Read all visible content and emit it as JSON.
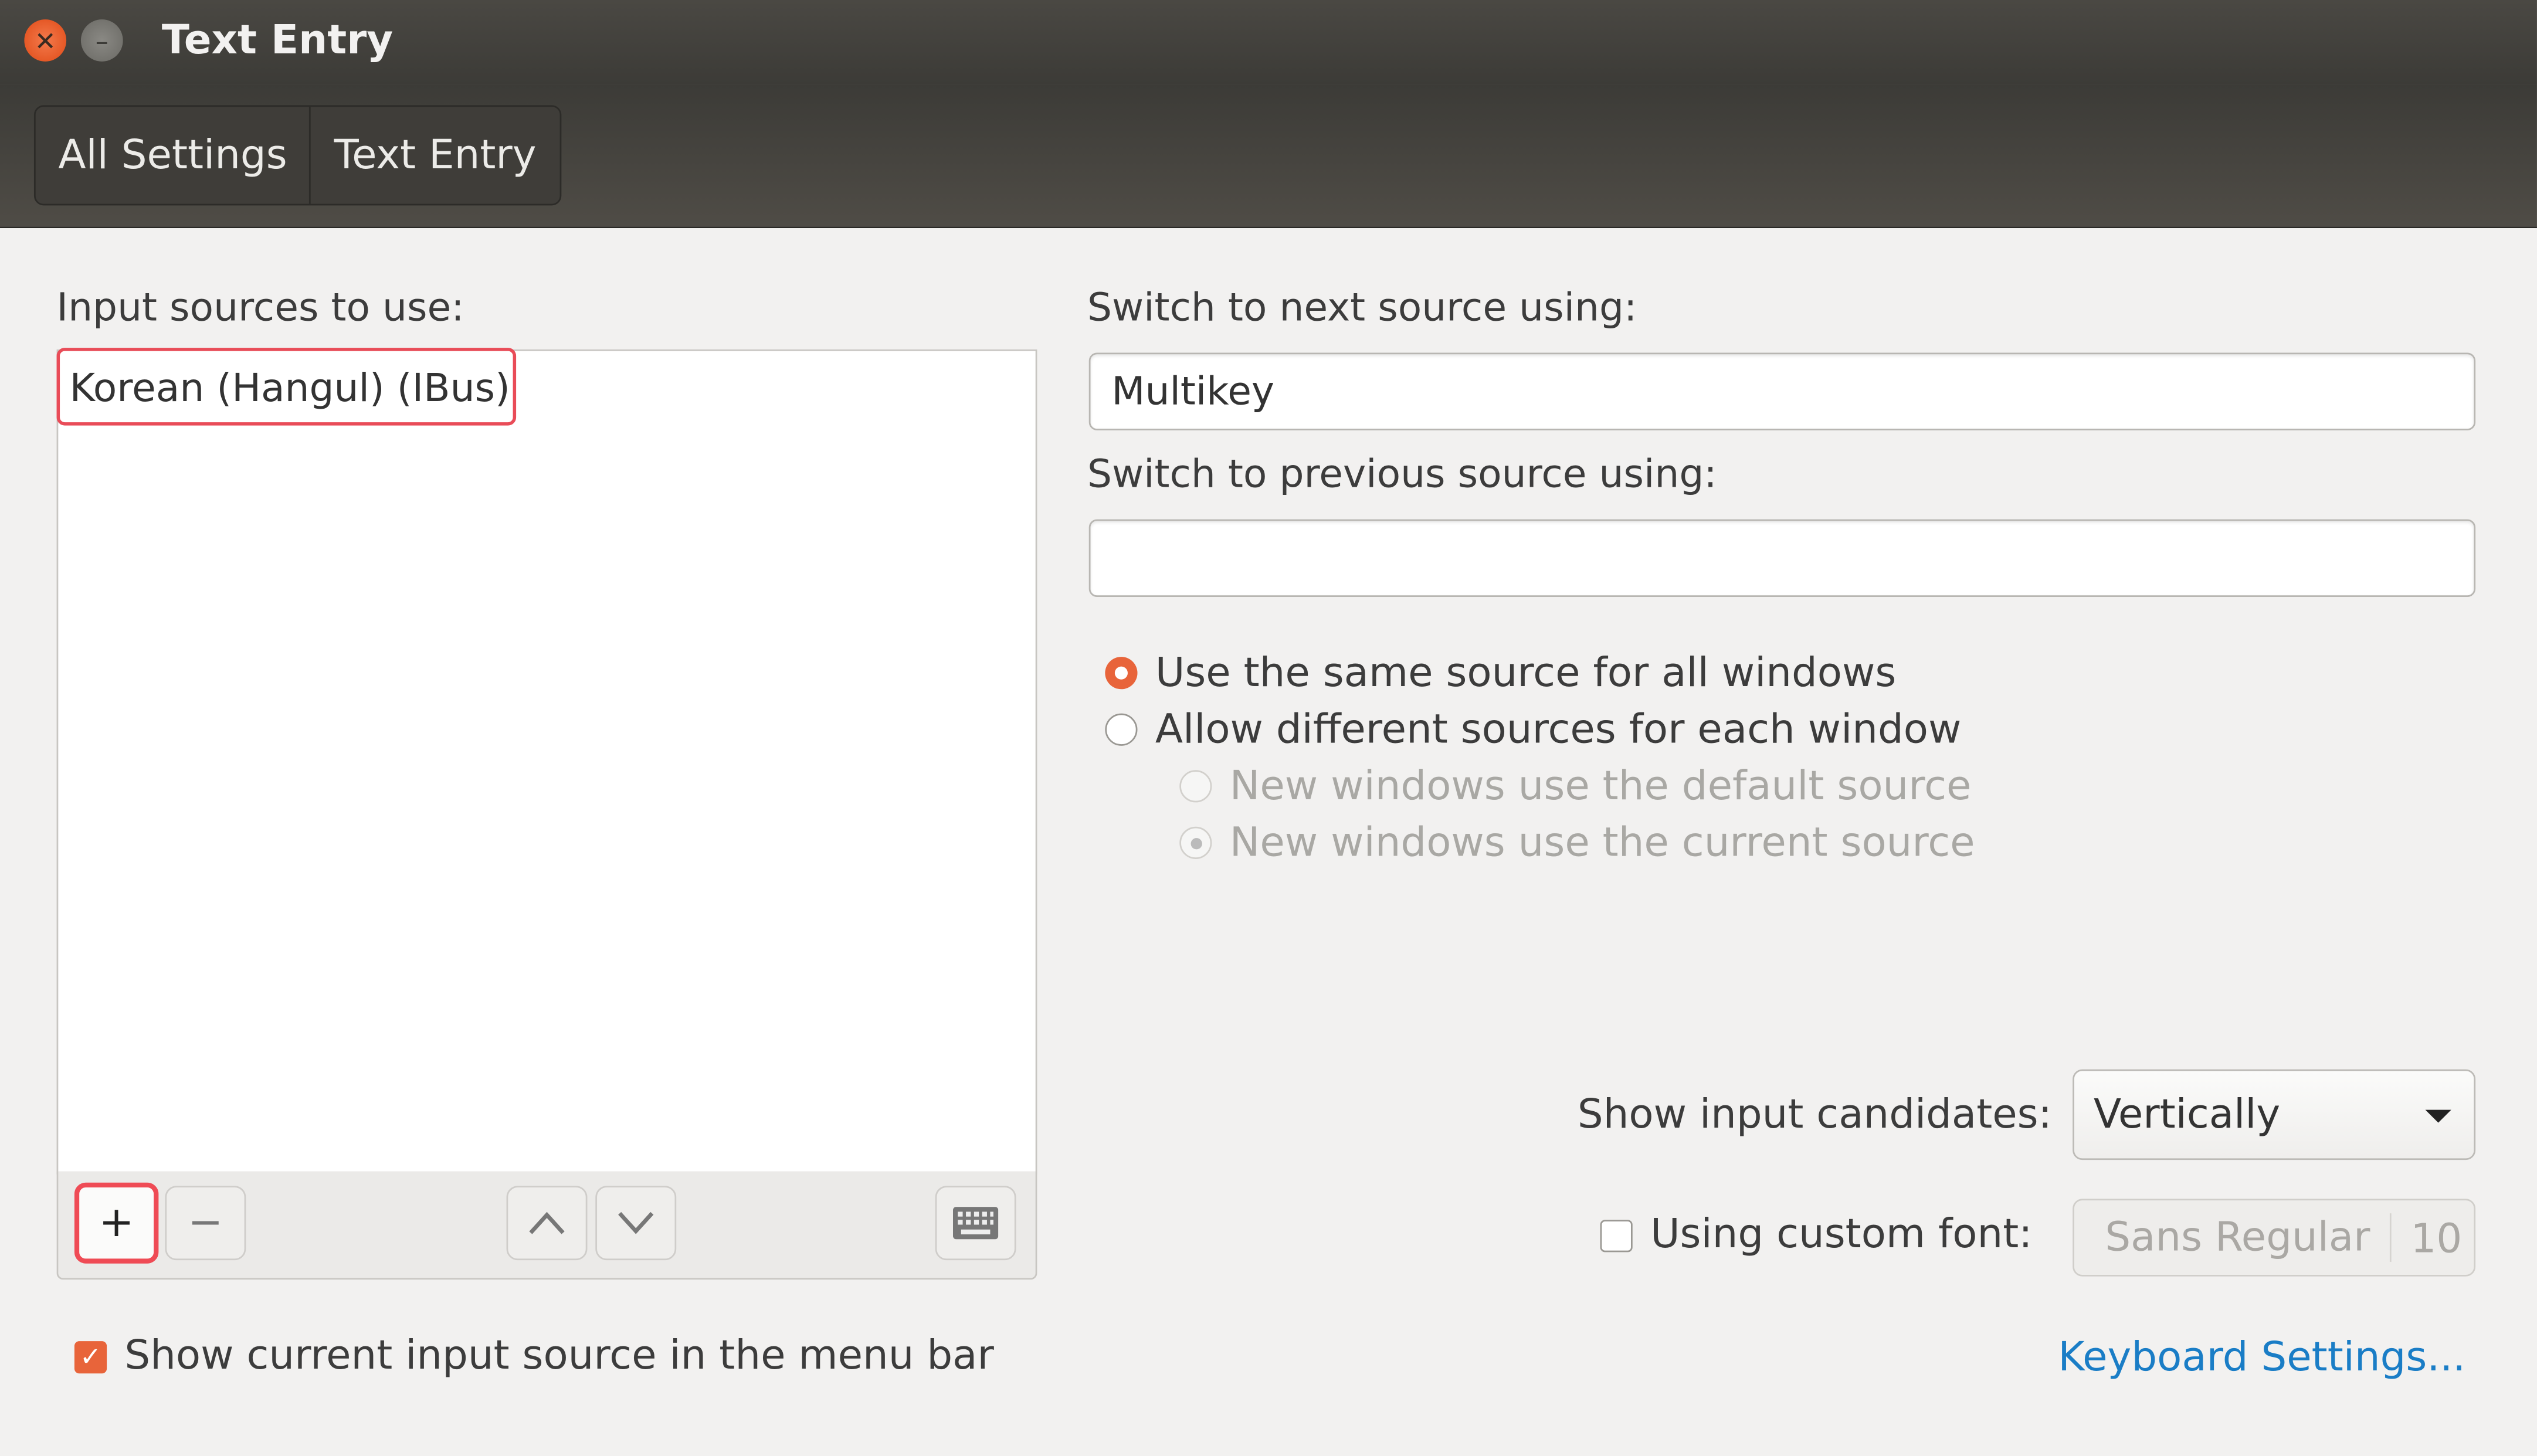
{
  "window": {
    "title": "Text Entry",
    "close_icon": "close-icon",
    "minimize_icon": "minimize-icon"
  },
  "breadcrumb": {
    "items": [
      "All Settings",
      "Text Entry"
    ]
  },
  "input_sources": {
    "label": "Input sources to use:",
    "items": [
      "Korean (Hangul) (IBus)"
    ],
    "buttons": {
      "add": "+",
      "remove": "−",
      "up": "up-chevron-icon",
      "down": "down-chevron-icon",
      "keyboard": "keyboard-icon"
    }
  },
  "switching": {
    "next_label": "Switch to next source using:",
    "next_value": "Multikey",
    "prev_label": "Switch to previous source using:",
    "prev_value": "",
    "radios": [
      {
        "label": "Use the same source for all windows",
        "checked": true,
        "enabled": true
      },
      {
        "label": "Allow different sources for each window",
        "checked": false,
        "enabled": true
      },
      {
        "label": "New windows use the default source",
        "checked": false,
        "enabled": false
      },
      {
        "label": "New windows use the current source",
        "checked": true,
        "enabled": false
      }
    ]
  },
  "candidates": {
    "label": "Show input candidates:",
    "value": "Vertically"
  },
  "custom_font": {
    "label": "Using custom font:",
    "checked": false,
    "font": "Sans Regular",
    "size": "10"
  },
  "show_in_menubar": {
    "label": "Show current input source in the menu bar",
    "checked": true
  },
  "keyboard_settings_link": "Keyboard Settings...",
  "colors": {
    "accent": "#e8643a",
    "highlight": "#e94c58",
    "link": "#1a7dc6"
  }
}
